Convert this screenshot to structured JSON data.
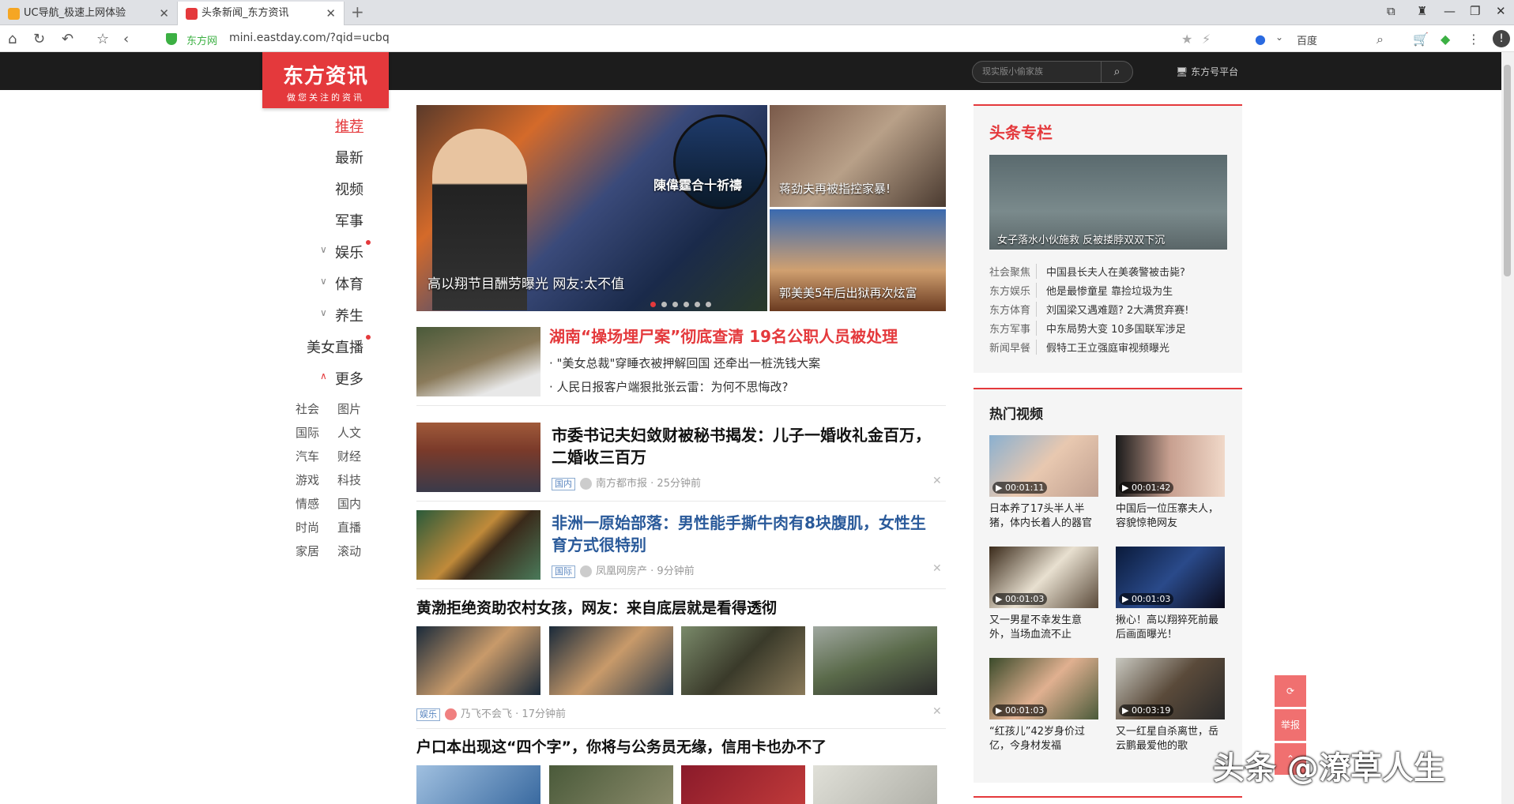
{
  "browser": {
    "tabs": [
      {
        "title": "UC导航_极速上网体验"
      },
      {
        "title": "头条新闻_东方资讯"
      }
    ],
    "site_badge": "东方网",
    "url": "mini.eastday.com/?qid=ucbq",
    "search_engine": "百度"
  },
  "header": {
    "logo_title": "东方资讯",
    "logo_slogan": "做您关注的资讯",
    "search_placeholder": "现实版小偷家族",
    "platform_link": "东方号平台"
  },
  "nav": {
    "main": [
      "推荐",
      "最新",
      "视频",
      "军事",
      "娱乐",
      "体育",
      "养生",
      "美女直播",
      "更多"
    ],
    "more_left": [
      "社会",
      "国际",
      "汽车",
      "游戏",
      "情感",
      "时尚",
      "家居"
    ],
    "more_right": [
      "图片",
      "人文",
      "财经",
      "科技",
      "国内",
      "直播",
      "滚动"
    ]
  },
  "hero": {
    "main_caption": "高以翔节目酬劳曝光 网友:太不值",
    "circle_caption": "陳偉霆合十祈禱",
    "top_right_caption": "蒋劲夫再被指控家暴!",
    "bottom_right_caption": "郭美美5年后出狱再次炫富"
  },
  "feed": {
    "top_story": {
      "headline": "湖南“操场埋尸案”彻底查清 19名公职人员被处理",
      "bullets": [
        "\"美女总裁\"穿睡衣被押解回国 还牵出一桩洗钱大案",
        "人民日报客户端狠批张云雷：为何不思悔改?"
      ]
    },
    "articles": [
      {
        "headline": "市委书记夫妇敛财被秘书揭发：儿子一婚收礼金百万，二婚收三百万",
        "tag": "国内",
        "source": "南方都市报",
        "time": "· 25分钟前"
      },
      {
        "headline": "非洲一原始部落：男性能手撕牛肉有8块腹肌，女性生育方式很特别",
        "tag": "国际",
        "source": "凤凰网房产",
        "time": "· 9分钟前"
      },
      {
        "headline": "黄渤拒绝资助农村女孩，网友：来自底层就是看得透彻",
        "tag": "娱乐",
        "source": "乃飞不会飞",
        "time": "· 17分钟前"
      },
      {
        "headline": "户口本出现这“四个字”，你将与公务员无缘，信用卡也办不了"
      }
    ]
  },
  "special": {
    "title": "头条专栏",
    "image_caption": "女子落水小伙施救 反被搂脖双双下沉",
    "rows": [
      {
        "cat": "社会聚焦",
        "text": "中国县长夫人在美袭警被击毙?"
      },
      {
        "cat": "东方娱乐",
        "text": "他是最惨童星 靠捡垃圾为生"
      },
      {
        "cat": "东方体育",
        "text": "刘国梁又遇难题? 2大满贯弃赛!"
      },
      {
        "cat": "东方军事",
        "text": "中东局势大变 10多国联军涉足"
      },
      {
        "cat": "新闻早餐",
        "text": "假特工王立强庭审视频曝光"
      }
    ]
  },
  "hot_videos": {
    "title": "热门视频",
    "items": [
      {
        "duration": "00:01:11",
        "title": "日本养了17头半人半猪，体内长着人的器官"
      },
      {
        "duration": "00:01:42",
        "title": "中国后一位压寨夫人，容貌惊艳网友"
      },
      {
        "duration": "00:01:03",
        "title": "又一男星不幸发生意外，当场血流不止"
      },
      {
        "duration": "00:01:03",
        "title": "揪心！高以翔猝死前最后画面曝光！"
      },
      {
        "duration": "00:01:03",
        "title": "“红孩儿”42岁身价过亿，今身材发福"
      },
      {
        "duration": "00:03:19",
        "title": "又一红星自杀离世，岳云鹏最爱他的歌"
      }
    ]
  },
  "float_buttons": {
    "report": "举报"
  },
  "watermark": "头条 @潦草人生",
  "colors": {
    "brand": "#e4393c",
    "link_blue": "#2a5a9a"
  }
}
